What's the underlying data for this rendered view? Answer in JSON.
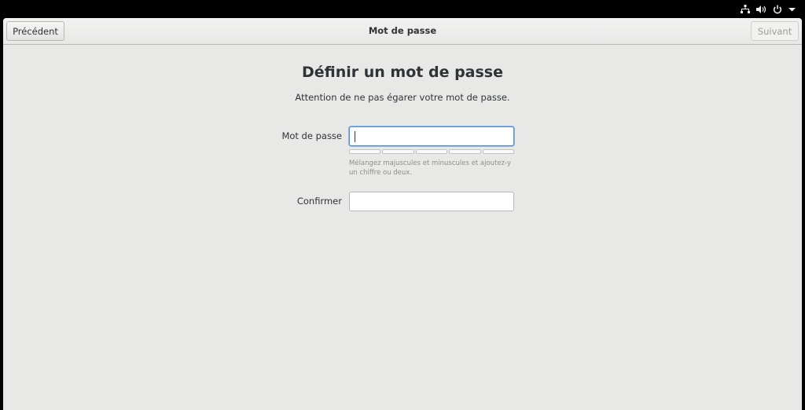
{
  "system_tray": {
    "icons": [
      "network-icon",
      "volume-icon",
      "power-icon",
      "dropdown-arrow-icon"
    ]
  },
  "header": {
    "title": "Mot de passe",
    "back_label": "Précédent",
    "next_label": "Suivant",
    "next_enabled": false
  },
  "page": {
    "heading": "Définir un mot de passe",
    "subtitle": "Attention de ne pas égarer votre mot de passe."
  },
  "form": {
    "password_label": "Mot de passe",
    "password_value": "",
    "strength_segments": 5,
    "strength_level": 0,
    "hint": "Mélangez majuscules et minuscules et ajoutez-y un chiffre ou deux.",
    "confirm_label": "Confirmer",
    "confirm_value": ""
  },
  "colors": {
    "background": "#e8e8e7",
    "focus_border": "#4a90d9",
    "text": "#2e3436",
    "hint_text": "#8c8f8b"
  }
}
